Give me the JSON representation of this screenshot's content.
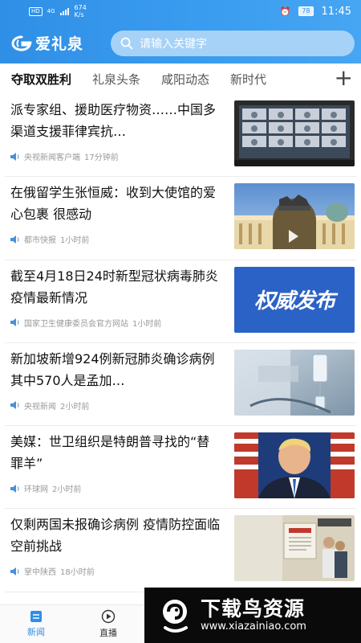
{
  "status_bar": {
    "hd": "HD",
    "network": "4G",
    "speed_value": "674",
    "speed_unit": "K/s",
    "battery": "78",
    "time": "11:45"
  },
  "app": {
    "name": "爱礼泉",
    "search_placeholder": "请输入关键字"
  },
  "tabs": [
    {
      "label": "夺取双胜利",
      "active": true
    },
    {
      "label": "礼泉头条",
      "active": false
    },
    {
      "label": "咸阳动态",
      "active": false
    },
    {
      "label": "新时代",
      "active": false
    }
  ],
  "tab_add": "+",
  "news": [
    {
      "title": "派专家组、援助医疗物资……中国多渠道支援菲律宾抗…",
      "source": "央视新闻客户端",
      "time": "17分钟前",
      "thumb": "video-conference"
    },
    {
      "title": "在俄留学生张恒威：收到大使馆的爱心包裹 很感动",
      "source": "都市快报",
      "time": "1小时前",
      "thumb": "palace-square"
    },
    {
      "title": "截至4月18日24时新型冠状病毒肺炎疫情最新情况",
      "source": "国家卫生健康委员会官方网站",
      "time": "1小时前",
      "thumb": "authority-release",
      "thumb_text": "权威发布"
    },
    {
      "title": "新加坡新增924例新冠肺炎确诊病例 其中570人是孟加…",
      "source": "央视新闻",
      "time": "2小时前",
      "thumb": "iv-drip"
    },
    {
      "title": "美媒：世卫组织是特朗普寻找的“替罪羊”",
      "source": "环球网",
      "time": "2小时前",
      "thumb": "press-briefing"
    },
    {
      "title": "仅剩两国未报确诊病例 疫情防控面临空前挑战",
      "source": "掌中陕西",
      "time": "18小时前",
      "thumb": "clinic-entrance"
    }
  ],
  "bottom_tabs": [
    {
      "label": "新闻",
      "active": true
    },
    {
      "label": "直播",
      "active": false
    }
  ],
  "watermark": {
    "title": "下载鸟资源",
    "url": "www.xiazainiao.com"
  },
  "colors": {
    "brand": "#2f8fe6",
    "meta": "#9a9a9a",
    "authority_blue": "#2b62c6"
  }
}
